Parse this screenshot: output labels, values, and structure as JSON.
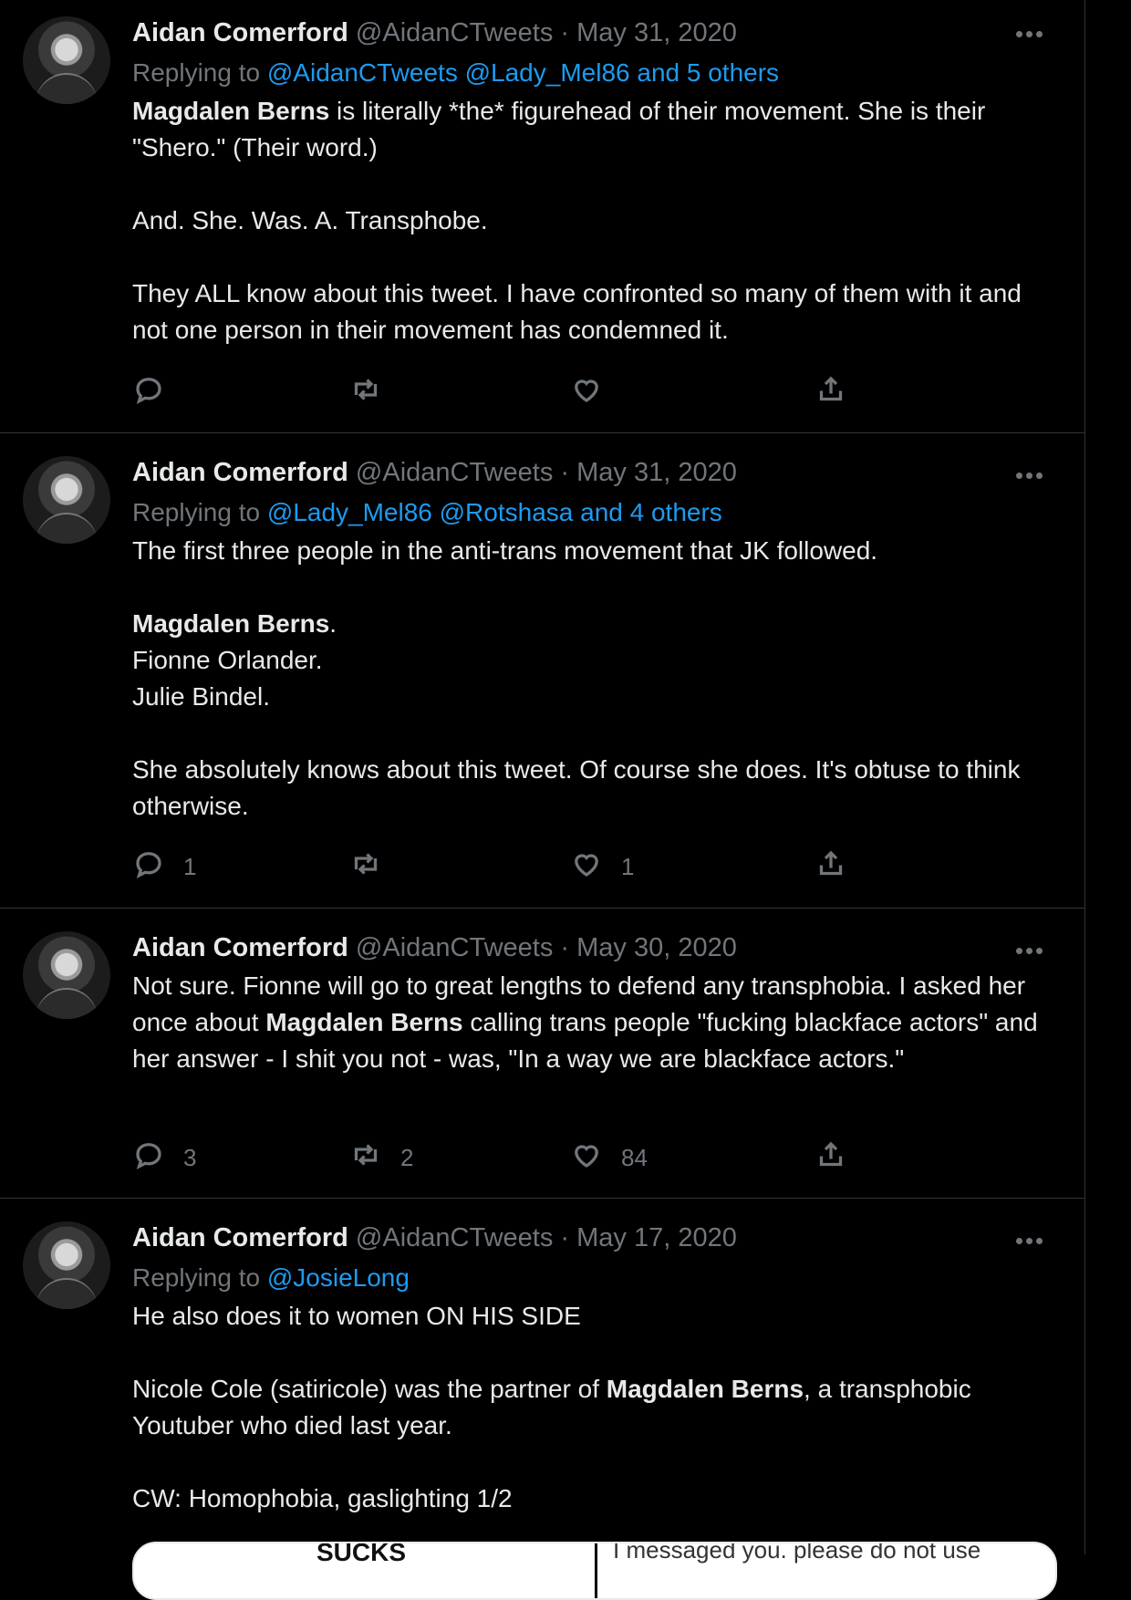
{
  "tweets": [
    {
      "name": "Aidan Comerford",
      "handle": "@AidanCTweets",
      "sep": " · ",
      "date": "May 31, 2020",
      "replying_prefix": "Replying to ",
      "replying_links": "@AidanCTweets @Lady_Mel86 and 5 others",
      "paragraphs": [
        [
          {
            "b": "Magdalen Berns"
          },
          {
            "t": " is literally *the* figurehead of their movement. She is their \"Shero.\" (Their word.)"
          }
        ],
        [
          {
            "t": "And. She. Was. A. Transphobe."
          }
        ],
        [
          {
            "t": "They ALL know about this tweet. I have confronted so many of them with it and not one person in their movement has condemned it."
          }
        ]
      ],
      "replies": "",
      "retweets": "",
      "likes": ""
    },
    {
      "name": "Aidan Comerford",
      "handle": "@AidanCTweets",
      "sep": " · ",
      "date": "May 31, 2020",
      "replying_prefix": "Replying to ",
      "replying_links": "@Lady_Mel86 @Rotshasa and 4 others",
      "paragraphs": [
        [
          {
            "t": "The first three people in the anti-trans movement that JK followed."
          }
        ],
        [
          {
            "b": "Magdalen Berns"
          },
          {
            "t": "."
          },
          {
            "br": true
          },
          {
            "t": "Fionne Orlander."
          },
          {
            "br": true
          },
          {
            "t": "Julie Bindel."
          }
        ],
        [
          {
            "t": "She absolutely knows about this tweet. Of course she does. It's obtuse to think otherwise."
          }
        ]
      ],
      "replies": "1",
      "retweets": "",
      "likes": "1"
    },
    {
      "name": "Aidan Comerford",
      "handle": "@AidanCTweets",
      "sep": " · ",
      "date": "May 30, 2020",
      "replying_prefix": "",
      "replying_links": "",
      "paragraphs": [
        [
          {
            "t": "Not sure. Fionne will go to great lengths to defend any transphobia. I asked her once about "
          },
          {
            "b": "Magdalen Berns"
          },
          {
            "t": " calling trans people \"fucking blackface actors\" and her answer - I shit you not - was, \"In a way we are blackface actors.\""
          }
        ]
      ],
      "replies": "3",
      "retweets": "2",
      "likes": "84"
    },
    {
      "name": "Aidan Comerford",
      "handle": "@AidanCTweets",
      "sep": " · ",
      "date": "May 17, 2020",
      "replying_prefix": "Replying to ",
      "replying_links": "@JosieLong",
      "paragraphs": [
        [
          {
            "t": "He also does it to women ON HIS SIDE"
          }
        ],
        [
          {
            "t": "Nicole Cole (satiricole) was the partner of "
          },
          {
            "b": "Magdalen Berns"
          },
          {
            "t": ", a transphobic Youtuber who died last year."
          }
        ],
        [
          {
            "t": "CW: Homophobia, gaslighting 1/2"
          }
        ]
      ],
      "replies": "",
      "retweets": "",
      "likes": ""
    }
  ],
  "media_preview": {
    "left_text": "SUCKS",
    "right_text": "I messaged you.  please do not use"
  },
  "icons": {
    "reply": "reply-icon",
    "retweet": "retweet-icon",
    "like": "heart-icon",
    "share": "share-icon",
    "more": "more-icon"
  },
  "colors": {
    "background": "#000000",
    "text": "#e7e9ea",
    "muted": "#71767b",
    "link": "#1d9bf0",
    "border": "#2f3336"
  }
}
